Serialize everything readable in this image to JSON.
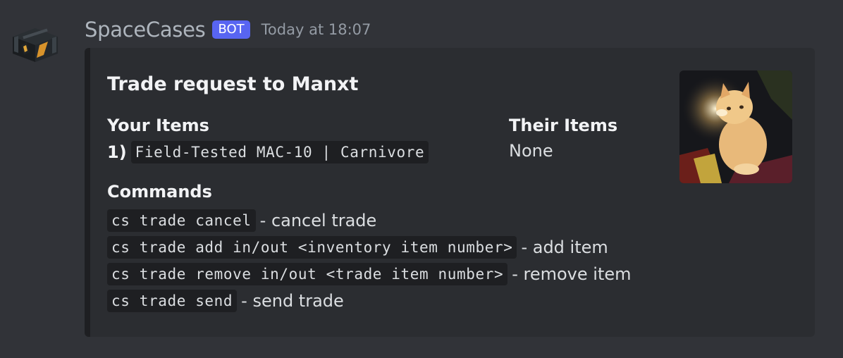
{
  "message": {
    "username": "SpaceCases",
    "badge": "BOT",
    "timestamp": "Today at 18:07",
    "avatar_icon": "weapon-case-icon"
  },
  "embed": {
    "title": "Trade request to Manxt",
    "your_items": {
      "name": "Your Items",
      "items": [
        {
          "index": "1)",
          "value": "Field-Tested MAC-10 | Carnivore"
        }
      ]
    },
    "their_items": {
      "name": "Their Items",
      "value": "None"
    },
    "commands": {
      "name": "Commands",
      "items": [
        {
          "code": "cs trade cancel",
          "desc": "- cancel trade"
        },
        {
          "code": "cs trade add in/out <inventory item number>",
          "desc": "- add item"
        },
        {
          "code": "cs trade remove in/out <trade item number>",
          "desc": "- remove item"
        },
        {
          "code": "cs trade send",
          "desc": "- send trade"
        }
      ]
    },
    "thumbnail_icon": "kitten-photo",
    "colors": {
      "background": "#313338",
      "embed_background": "#2b2d31",
      "badge": "#5865f2",
      "code_background": "#1e1f22"
    }
  }
}
